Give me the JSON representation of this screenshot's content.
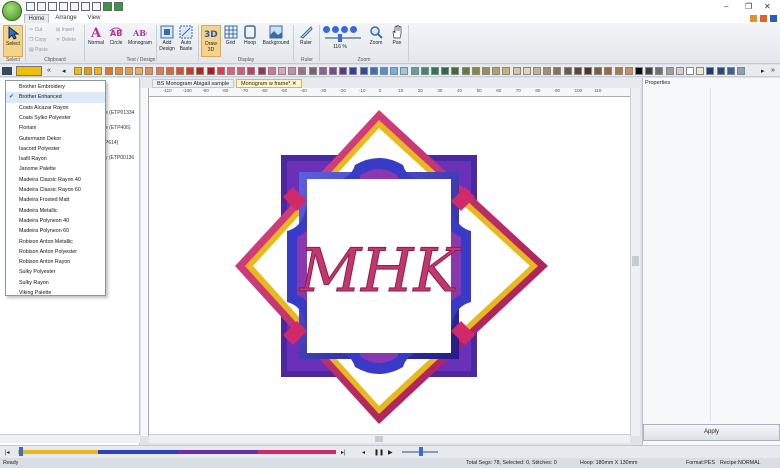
{
  "titlebar": {
    "title": ""
  },
  "tabs": [
    "Home",
    "Arrange",
    "View"
  ],
  "ribbon": {
    "select": "Select",
    "clipboard": {
      "cut": "Cut",
      "copy": "Copy",
      "paste": "Paste",
      "insert": "Insert",
      "delete": "Delete",
      "label": "Clipboard"
    },
    "text_design": {
      "normal": "Normal",
      "circle": "Circle",
      "monogram": "Monogram",
      "label": "Text / Design"
    },
    "add_design": "Add Design",
    "auto_baste": "Auto Baste",
    "display": {
      "draw3d": "Draw 3D",
      "grid": "Grid",
      "hoop": "Hoop",
      "background": "Background",
      "label": "Display"
    },
    "ruler": {
      "ruler": "Ruler",
      "label": "Ruler"
    },
    "zoom": {
      "percent": "116 %",
      "zoom": "Zoom",
      "pan": "Pan",
      "label": "Zoom"
    },
    "select_group": "Select"
  },
  "palette_colors": [
    "#f0c000",
    "#e8a000",
    "#f5b400",
    "#e07820",
    "#f08c28",
    "#ec9a3c",
    "#f4a860",
    "#ee8a50",
    "#e87848",
    "#e46430",
    "#d85024",
    "#cc3c1c",
    "#c02018",
    "#b8181c",
    "#e03c4c",
    "#e85c78",
    "#d8587c",
    "#c04064",
    "#a0305c",
    "#d87098",
    "#e0a0b8",
    "#c88aa8",
    "#a07088",
    "#806070",
    "#906090",
    "#7a4a8e",
    "#5a3a8a",
    "#3c3c98",
    "#2c4ca8",
    "#3870c0",
    "#4894d8",
    "#70b0e0",
    "#98c8e8",
    "#60a0a0",
    "#408878",
    "#287860",
    "#306848",
    "#486838",
    "#687838",
    "#888840",
    "#a09050",
    "#b8a060",
    "#c8b078",
    "#d8c498",
    "#e4d4b0",
    "#c8b090",
    "#a88c70",
    "#8c7058",
    "#705848",
    "#5c4838",
    "#4c3828",
    "#7c5c3c",
    "#986c40",
    "#b07848",
    "#c89060",
    "#101010",
    "#404040",
    "#707070",
    "#a0a0a0",
    "#d0d0d0",
    "#ffffff",
    "#f0e8d0",
    "#1c3c6c",
    "#284c78",
    "#3c6090",
    "#88a0b8"
  ],
  "dropdown": {
    "items": [
      "Brother Embroidery",
      "Brother Enhanced",
      "Coats Alcazar Rayon",
      "Coats Sylko Polyester",
      "Floriani",
      "Gutermann Dekor",
      "Isacord Polyester",
      "Isafil Rayon",
      "Janome Palette",
      "Madeira Classic Rayon 40",
      "Madeira Classic Rayon 60",
      "Madeira Frosted Matt",
      "Madeira Metallic",
      "Madeira Polyneon 40",
      "Madeira Polyneon 60",
      "Robison Anton Metallic",
      "Robison Anton Polyester",
      "Robison Anton Rayon",
      "Sulky Polyester",
      "Sulky Rayon",
      "Viking Palette"
    ],
    "selected_index": 1
  },
  "behind_list": [
    "e (ETP01334",
    "e (ETP406)",
    "P614)",
    "y (ETP00136"
  ],
  "doc_tabs": [
    "BS Monogram Abigail sample",
    "Monogram w frame*"
  ],
  "ruler_ticks": [
    "-110",
    "-100",
    "-90",
    "-80",
    "-70",
    "-60",
    "-50",
    "-40",
    "-30",
    "-20",
    "-10",
    "0",
    "10",
    "20",
    "30",
    "40",
    "50",
    "60",
    "70",
    "80",
    "90",
    "100",
    "110"
  ],
  "monogram": {
    "letters": "MHK",
    "letter_color": "#c2386e"
  },
  "frame_colors": {
    "pink": "#d02a6a",
    "gold": "#e8b81c",
    "purple": "#6a2fa8",
    "blue": "#3040b8",
    "violet": "#8a3aa8"
  },
  "properties": {
    "title": "Properties",
    "apply": "Apply"
  },
  "status": {
    "ready": "Ready",
    "segs": "Total Segs: 78, Selected: 0, Stitches: 0",
    "hoop": "Hoop: 180mm X 130mm",
    "format": "Format:PES",
    "recipe": "Recipe:NORMAL"
  },
  "sim_colors": [
    "#e8b81c",
    "#3040b8",
    "#6a2fa8",
    "#d02a6a"
  ]
}
